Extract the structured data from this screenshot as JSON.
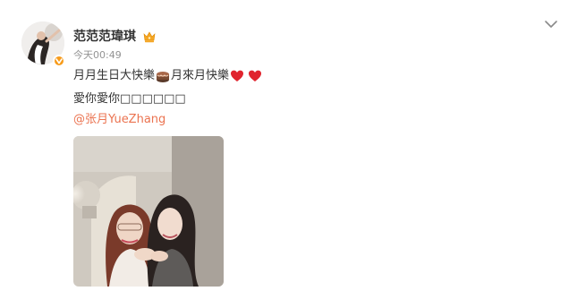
{
  "user": {
    "name": "范范范瑋琪",
    "timestamp": "今天00:49"
  },
  "post": {
    "line1_part1": "月月生日大快樂",
    "line1_part2": "月來月快樂",
    "line2": "愛你愛你□□□□□□",
    "mention": "@张月YueZhang"
  },
  "icons": {
    "menu": "chevron-down-icon",
    "vip": "crown-badge-icon",
    "verified": "verified-badge-icon",
    "cake": "cake-emoji-icon",
    "heart": "red-heart-emoji-icon"
  },
  "colors": {
    "accent_link": "#eb7350",
    "timestamp": "#939393",
    "verified": "#f79b1a",
    "heart": "#e0242e"
  }
}
